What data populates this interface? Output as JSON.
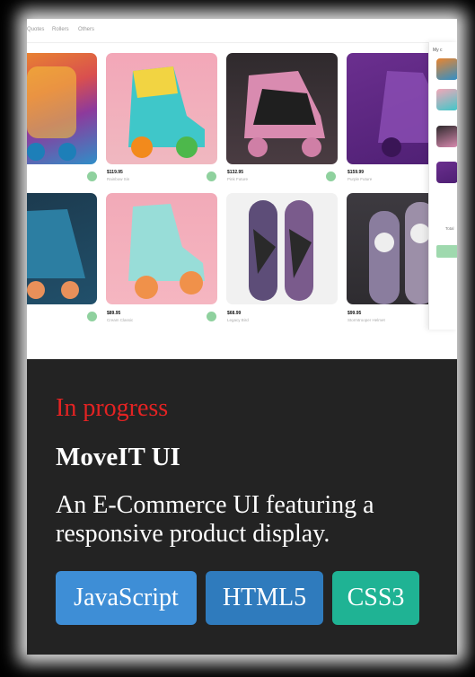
{
  "screenshot": {
    "nav": [
      "Quotes",
      "Rollers",
      "Others"
    ],
    "products": [
      {
        "price": "",
        "name": ""
      },
      {
        "price": "$119.95",
        "name": "Rainbow Sin"
      },
      {
        "price": "$132.95",
        "name": "Pink Future"
      },
      {
        "price": "$159.99",
        "name": "Purple Future"
      },
      {
        "price": "",
        "name": ""
      },
      {
        "price": "$89.95",
        "name": "Cream Classic"
      },
      {
        "price": "$68.99",
        "name": "Legacy Bird"
      },
      {
        "price": "$99.95",
        "name": "Stormtrooper Helmet"
      }
    ],
    "cart": {
      "header": "My c",
      "total": "Total"
    }
  },
  "project": {
    "status": "In progress",
    "title": "MoveIT UI",
    "description": "An E-Commerce UI featuring a responsive product display."
  },
  "tags": [
    {
      "label": "JavaScript",
      "color": "#3e8ed6"
    },
    {
      "label": "HTML5",
      "color": "#2f7bbd"
    },
    {
      "label": "CSS3",
      "color": "#1fb394"
    }
  ]
}
